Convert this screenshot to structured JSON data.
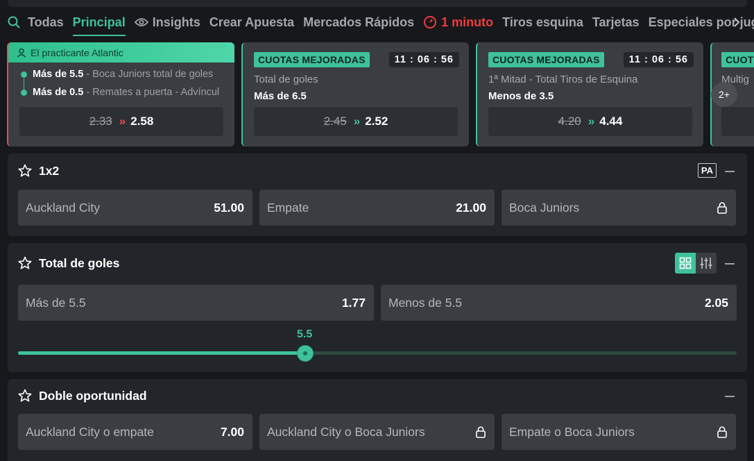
{
  "nav": {
    "items": [
      "Todas",
      "Principal",
      "Insights",
      "Crear Apuesta",
      "Mercados Rápidos",
      "1 minuto",
      "Tiros esquina",
      "Tarjetas",
      "Especiales por jugad"
    ],
    "active": "Principal",
    "icons": {
      "search": "search-icon",
      "insights": "eye-icon",
      "live": "stopwatch-icon",
      "next": "chevron-right-icon"
    }
  },
  "cards": [
    {
      "header": "El practicante Atlantic",
      "legs": [
        {
          "bold": "Más de 5.5",
          "rest": " - Boca Juniors total de goles"
        },
        {
          "bold": "Más de 0.5",
          "rest": " - Remates a puerta - Advíncul"
        }
      ],
      "old_odds": "2.33",
      "new_odds": "2.58",
      "arrow": "»",
      "arrow_color": "#f04a4a"
    },
    {
      "badge": "CUOTAS MEJORADAS",
      "timer": "11 : 06 : 56",
      "title": "Total de goles",
      "selection": "Más de 6.5",
      "old_odds": "2.45",
      "new_odds": "2.52",
      "arrow": "»",
      "arrow_color": "#3fc29b"
    },
    {
      "badge": "CUOTAS MEJORADAS",
      "timer": "11 : 06 : 56",
      "title": "1ª Mitad - Total Tiros de Esquina",
      "selection": "Menos de 3.5",
      "old_odds": "4.20",
      "new_odds": "4.44",
      "arrow": "»",
      "arrow_color": "#3fc29b"
    },
    {
      "badge": "CUOT",
      "title": "Multig",
      "next_label": "2+"
    }
  ],
  "markets": {
    "m1x2": {
      "title": "1x2",
      "badge": "PA",
      "options": [
        {
          "label": "Auckland City",
          "odds": "51.00"
        },
        {
          "label": "Empate",
          "odds": "21.00"
        },
        {
          "label": "Boca Juniors",
          "odds": ""
        }
      ]
    },
    "total": {
      "title": "Total de goles",
      "options": [
        {
          "label": "Más de 5.5",
          "odds": "1.77"
        },
        {
          "label": "Menos de 5.5",
          "odds": "2.05"
        }
      ],
      "slider_value": "5.5",
      "slider_fraction": 0.5
    },
    "doble": {
      "title": "Doble oportunidad",
      "options": [
        {
          "label": "Auckland City o empate",
          "odds": "7.00"
        },
        {
          "label": "Auckland City o Boca Juniors",
          "odds": ""
        },
        {
          "label": "Empate o Boca Juniors",
          "odds": ""
        }
      ]
    }
  },
  "colors": {
    "accent": "#3fc29b",
    "live": "#f23b3b",
    "panel": "#22252a",
    "button": "#3a3d42"
  }
}
